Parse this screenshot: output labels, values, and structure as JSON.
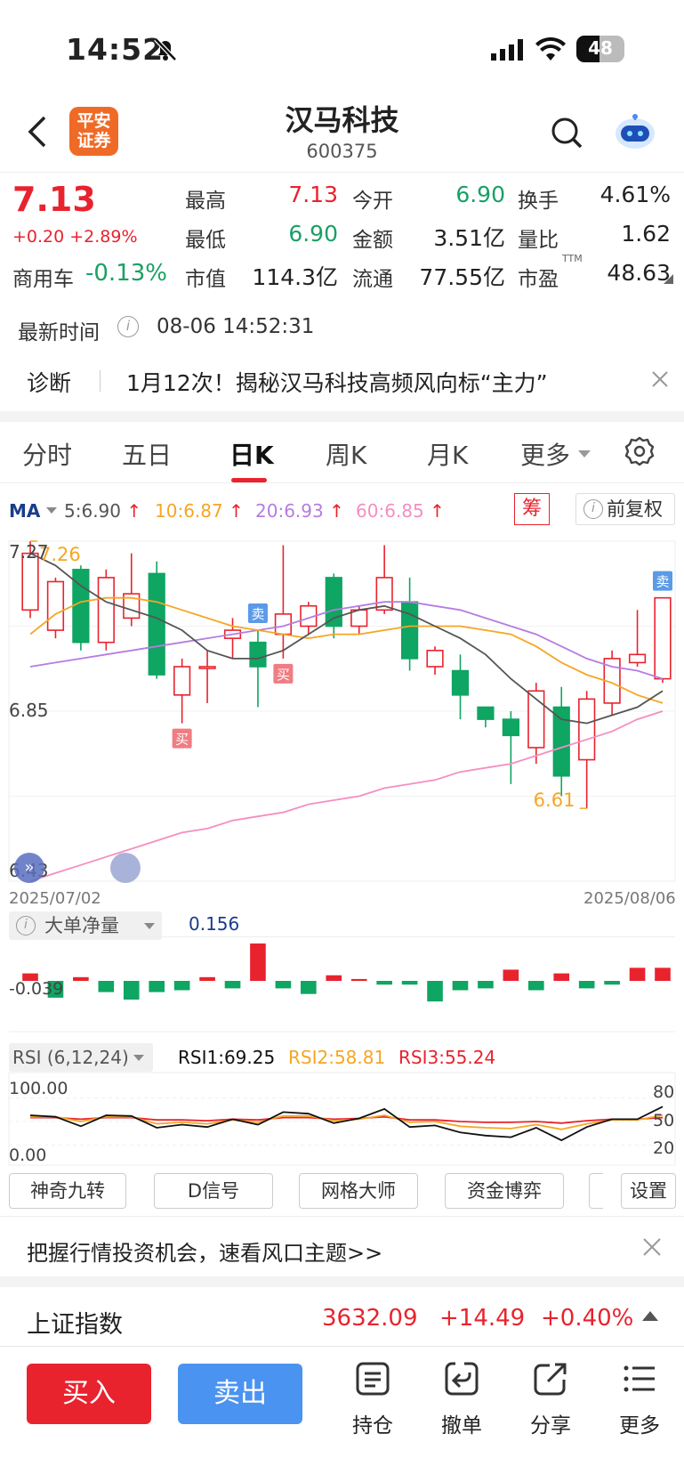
{
  "status_bar": {
    "time": "14:52",
    "battery": "48"
  },
  "header": {
    "title": "汉马科技",
    "code": "600375",
    "logo_line1": "平安",
    "logo_line2": "证券"
  },
  "quote": {
    "price": "7.13",
    "change": "+0.20 +2.89%",
    "sector": "商用车",
    "sector_change": "-0.13%",
    "fields": [
      {
        "label": "最高",
        "value": "7.13"
      },
      {
        "label": "今开",
        "value": "6.90"
      },
      {
        "label": "换手",
        "value": "4.61%"
      },
      {
        "label": "最低",
        "value": "6.90"
      },
      {
        "label": "金额",
        "value": "3.51亿"
      },
      {
        "label": "量比",
        "value": "1.62"
      },
      {
        "label": "市值",
        "value": "114.3亿"
      },
      {
        "label": "流通",
        "value": "77.55亿"
      },
      {
        "label": "市盈",
        "value": "48.63",
        "sup": "TTM"
      }
    ]
  },
  "update": {
    "label": "最新时间",
    "value": "08-06 14:52:31"
  },
  "diagnosis": {
    "label": "诊断",
    "text": "1月12次！揭秘汉马科技高频风向标“主力”"
  },
  "tabs": [
    "分时",
    "五日",
    "日K",
    "周K",
    "月K",
    "更多"
  ],
  "ma_bar": {
    "label": "MA",
    "ma5": "5:6.90",
    "ma10": "10:6.87",
    "ma20": "20:6.93",
    "ma60": "60:6.85",
    "chip": "筹",
    "adjust": "前复权",
    "colors": {
      "ma5": "#555555",
      "ma10": "#f5a623",
      "ma20": "#b57de0",
      "ma60": "#f48fc1"
    }
  },
  "chart_data": {
    "type": "candlestick",
    "start_date": "2025/07/02",
    "end_date": "2025/08/06",
    "y_axis_labels": [
      "7.27",
      "6.85",
      "6.43"
    ],
    "ylim": [
      6.43,
      7.27
    ],
    "high_label": "7.26",
    "low_label": "6.61",
    "candles": [
      {
        "o": 7.1,
        "c": 7.24,
        "h": 7.27,
        "l": 7.08
      },
      {
        "o": 7.05,
        "c": 7.17,
        "h": 7.18,
        "l": 7.03
      },
      {
        "o": 7.2,
        "c": 7.02,
        "h": 7.21,
        "l": 7.0
      },
      {
        "o": 7.02,
        "c": 7.18,
        "h": 7.2,
        "l": 7.0
      },
      {
        "o": 7.08,
        "c": 7.14,
        "h": 7.24,
        "l": 7.06
      },
      {
        "o": 7.19,
        "c": 6.94,
        "h": 7.22,
        "l": 6.93
      },
      {
        "o": 6.89,
        "c": 6.96,
        "h": 6.98,
        "l": 6.82
      },
      {
        "o": 6.96,
        "c": 6.96,
        "h": 7.0,
        "l": 6.87
      },
      {
        "o": 7.03,
        "c": 7.05,
        "h": 7.08,
        "l": 6.98
      },
      {
        "o": 7.02,
        "c": 6.96,
        "h": 7.05,
        "l": 6.86
      },
      {
        "o": 7.04,
        "c": 7.09,
        "h": 7.26,
        "l": 6.98
      },
      {
        "o": 7.06,
        "c": 7.11,
        "h": 7.12,
        "l": 7.04
      },
      {
        "o": 7.18,
        "c": 7.06,
        "h": 7.19,
        "l": 7.03
      },
      {
        "o": 7.06,
        "c": 7.1,
        "h": 7.11,
        "l": 7.04
      },
      {
        "o": 7.1,
        "c": 7.18,
        "h": 7.26,
        "l": 7.09
      },
      {
        "o": 7.12,
        "c": 6.98,
        "h": 7.18,
        "l": 6.95
      },
      {
        "o": 6.96,
        "c": 7.0,
        "h": 7.01,
        "l": 6.94
      },
      {
        "o": 6.95,
        "c": 6.89,
        "h": 6.99,
        "l": 6.83
      },
      {
        "o": 6.86,
        "c": 6.83,
        "h": 6.86,
        "l": 6.81
      },
      {
        "o": 6.83,
        "c": 6.79,
        "h": 6.85,
        "l": 6.67
      },
      {
        "o": 6.76,
        "c": 6.9,
        "h": 6.92,
        "l": 6.72
      },
      {
        "o": 6.86,
        "c": 6.69,
        "h": 6.91,
        "l": 6.64
      },
      {
        "o": 6.73,
        "c": 6.88,
        "h": 6.9,
        "l": 6.61
      },
      {
        "o": 6.87,
        "c": 6.98,
        "h": 7.0,
        "l": 6.84
      },
      {
        "o": 6.97,
        "c": 6.99,
        "h": 7.1,
        "l": 6.96
      },
      {
        "o": 6.93,
        "c": 7.13,
        "h": 7.13,
        "l": 6.92
      }
    ],
    "ma5": [
      7.24,
      7.21,
      7.16,
      7.12,
      7.1,
      7.08,
      7.05,
      7.0,
      6.98,
      6.98,
      7.0,
      7.04,
      7.08,
      7.1,
      7.11,
      7.09,
      7.06,
      7.03,
      6.99,
      6.93,
      6.88,
      6.83,
      6.82,
      6.84,
      6.86,
      6.9
    ],
    "ma10": [
      7.04,
      7.09,
      7.12,
      7.13,
      7.13,
      7.12,
      7.1,
      7.08,
      7.06,
      7.05,
      7.04,
      7.03,
      7.04,
      7.04,
      7.05,
      7.06,
      7.06,
      7.06,
      7.05,
      7.04,
      7.01,
      6.97,
      6.94,
      6.92,
      6.89,
      6.87
    ],
    "ma20": [
      6.96,
      6.97,
      6.98,
      6.99,
      7.0,
      7.01,
      7.02,
      7.03,
      7.04,
      7.05,
      7.06,
      7.08,
      7.1,
      7.11,
      7.12,
      7.12,
      7.11,
      7.1,
      7.08,
      7.06,
      7.04,
      7.01,
      6.98,
      6.96,
      6.95,
      6.93
    ],
    "ma60": [
      6.43,
      6.45,
      6.47,
      6.49,
      6.51,
      6.53,
      6.55,
      6.56,
      6.58,
      6.59,
      6.6,
      6.62,
      6.63,
      6.64,
      6.66,
      6.67,
      6.68,
      6.7,
      6.71,
      6.72,
      6.74,
      6.76,
      6.78,
      6.8,
      6.83,
      6.85
    ],
    "markers": [
      {
        "type": "买",
        "index": 6
      },
      {
        "type": "卖",
        "index": 9
      },
      {
        "type": "买",
        "index": 10
      },
      {
        "type": "卖",
        "index": 25
      }
    ]
  },
  "flow": {
    "label": "大单净量",
    "value": "0.156",
    "axis_label": "-0.039",
    "values": [
      0.04,
      -0.09,
      0.02,
      -0.06,
      -0.1,
      -0.06,
      -0.05,
      0.02,
      -0.04,
      0.2,
      -0.04,
      -0.07,
      0.03,
      0.01,
      -0.02,
      -0.02,
      -0.11,
      -0.05,
      -0.04,
      0.06,
      -0.05,
      0.04,
      -0.04,
      -0.02,
      0.07,
      0.07
    ]
  },
  "rsi": {
    "label": "RSI (6,12,24)",
    "rsi1": "RSI1:69.25",
    "rsi2": "RSI2:58.81",
    "rsi3": "RSI3:55.24",
    "y_top": "100.00",
    "y_bottom": "0.00",
    "levels": [
      "80",
      "50",
      "20"
    ],
    "rsi1_values": [
      58,
      56,
      44,
      58,
      57,
      42,
      46,
      43,
      53,
      46,
      62,
      60,
      48,
      54,
      66,
      43,
      45,
      36,
      32,
      30,
      42,
      26,
      43,
      53,
      53,
      69
    ],
    "rsi2_values": [
      56,
      56,
      50,
      56,
      56,
      47,
      49,
      47,
      52,
      49,
      57,
      57,
      51,
      53,
      58,
      49,
      50,
      44,
      42,
      41,
      46,
      40,
      47,
      52,
      52,
      58
    ],
    "rsi3_values": [
      55,
      55,
      53,
      55,
      55,
      52,
      52,
      51,
      53,
      52,
      55,
      55,
      53,
      54,
      56,
      52,
      52,
      50,
      49,
      49,
      50,
      48,
      51,
      53,
      53,
      55
    ]
  },
  "tools": [
    "神奇九转",
    "D信号",
    "网格大师",
    "资金博弈",
    "设置"
  ],
  "banner": {
    "text": "把握行情投资机会，速看风口主题>>"
  },
  "index_bar": {
    "name": "上证指数",
    "value": "3632.09",
    "change": "+14.49",
    "pct": "+0.40%"
  },
  "bottom": {
    "buy": "买入",
    "sell": "卖出",
    "items": [
      "持仓",
      "撤单",
      "分享",
      "更多"
    ]
  }
}
